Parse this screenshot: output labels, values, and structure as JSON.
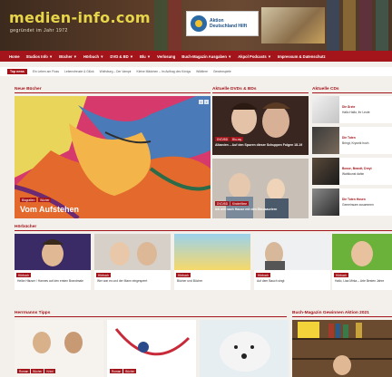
{
  "header": {
    "logo": "medien-info.com",
    "tagline": "gegründet im Jahr 1972",
    "ad_text_line1": "Aktion",
    "ad_text_line2": "Deutschland Hilft"
  },
  "nav": {
    "items": [
      "Home",
      "Studios Info ▼",
      "Bücher ▼",
      "Hörbuch ▼",
      "DVD & BD ▼",
      "Blu ▼",
      "Verlosung",
      "Buch-Magazin Ausgaben ▼",
      "Akpol Podcasts ▼",
      "Impressum & Datenschutz"
    ]
  },
  "ticker": {
    "label": "Top news",
    "items": [
      "Ein Leben am Fluss",
      "Lebensfreude & Glück",
      "Wolfsburg – Der Vampir",
      "Kleine Mädchen – Im Auftrag des Königs",
      "Wildtiere",
      "Gewinnspiele"
    ]
  },
  "sections": {
    "new_books": "Neue Bücher",
    "dvds": "Aktuelle DVDs & BDs",
    "cds": "Aktuelle CDs",
    "audiobooks": "Hörbücher",
    "tips": "Herrmanns Tipps",
    "mag": "Buch-Magazin Gewinnen Aktion 2021"
  },
  "feature": {
    "tags": [
      "Biografien",
      "Bücher"
    ],
    "title": "Vom Aufstehen"
  },
  "dvd": [
    {
      "tags": [
        "DVD/BD",
        "Blu-ray"
      ],
      "title": "Albanien – Auf den Spuren dieser Schuppen Folgen 18-19"
    },
    {
      "tags": [
        "DVD/BD",
        "Kinderfilme"
      ],
      "title": "Ich will nach Hause mit den Dinosauriern"
    }
  ],
  "cds": [
    {
      "kicker": "Die Ärzte",
      "title": "Hallo Hallo, ihr Leute"
    },
    {
      "kicker": "Die Toten",
      "title": "Bringt, Kryonik hoch"
    },
    {
      "kicker": "Bosse, Brandt, Dreyt",
      "title": "Wahlkunst dahin"
    },
    {
      "kicker": "Die Toten Hosen",
      "title": "Gemeinsam zusammen"
    }
  ],
  "audiobooks": [
    {
      "title": "Heike Häuser / Hannes auf den ersten Brandmale"
    },
    {
      "title": "Wer war es und der Mann eingesperrt"
    },
    {
      "title": "Bücher und Bücher"
    },
    {
      "title": "Auf dem Bauch singt"
    },
    {
      "title": "Hallo, Lisa Mirka – Arte Besten Jahre"
    }
  ],
  "tips_tags": [
    "Roman",
    "Bücher",
    "Krimi"
  ]
}
